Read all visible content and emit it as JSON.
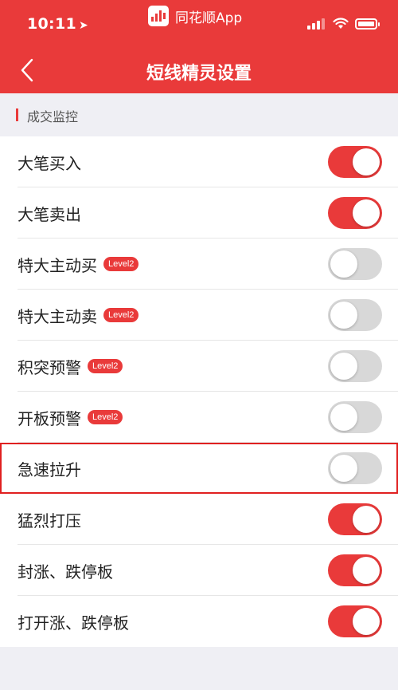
{
  "status_bar": {
    "time": "10:11",
    "location_icon": "location-arrow-icon",
    "app_name": "同花顺App"
  },
  "nav": {
    "title": "短线精灵设置",
    "back_icon": "chevron-left-icon"
  },
  "section": {
    "label": "成交监控"
  },
  "colors": {
    "accent": "#e93a3a",
    "toggle_off": "#d8d8d8",
    "highlight_border": "#e02020"
  },
  "settings": [
    {
      "label": "大笔买入",
      "badge": "",
      "on": true
    },
    {
      "label": "大笔卖出",
      "badge": "",
      "on": true
    },
    {
      "label": "特大主动买",
      "badge": "Level2",
      "on": false
    },
    {
      "label": "特大主动卖",
      "badge": "Level2",
      "on": false
    },
    {
      "label": "积突预警",
      "badge": "Level2",
      "on": false
    },
    {
      "label": "开板预警",
      "badge": "Level2",
      "on": false
    },
    {
      "label": "急速拉升",
      "badge": "",
      "on": false,
      "highlighted": true
    },
    {
      "label": "猛烈打压",
      "badge": "",
      "on": true
    },
    {
      "label": "封涨、跌停板",
      "badge": "",
      "on": true
    },
    {
      "label": "打开涨、跌停板",
      "badge": "",
      "on": true
    }
  ]
}
